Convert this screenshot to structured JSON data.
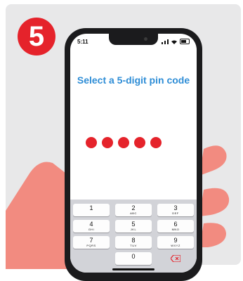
{
  "step": {
    "number": "5"
  },
  "status": {
    "time": "5:11"
  },
  "screen": {
    "prompt": "Select a 5-digit pin code"
  },
  "pin": {
    "length": 5,
    "filled": 5,
    "dot_color": "#e5232b"
  },
  "keypad": {
    "keys": [
      {
        "num": "1",
        "letters": ""
      },
      {
        "num": "2",
        "letters": "ABC"
      },
      {
        "num": "3",
        "letters": "DEF"
      },
      {
        "num": "4",
        "letters": "GHI"
      },
      {
        "num": "5",
        "letters": "JKL"
      },
      {
        "num": "6",
        "letters": "MNO"
      },
      {
        "num": "7",
        "letters": "PQRS"
      },
      {
        "num": "8",
        "letters": "TUV"
      },
      {
        "num": "9",
        "letters": "WXYZ"
      },
      {
        "num": "0",
        "letters": ""
      }
    ],
    "delete_icon": "backspace-icon"
  },
  "colors": {
    "accent_red": "#e5232b",
    "prompt_blue": "#2e8dd6",
    "card_bg": "#e8e8e9",
    "skin": "#f28b80"
  }
}
